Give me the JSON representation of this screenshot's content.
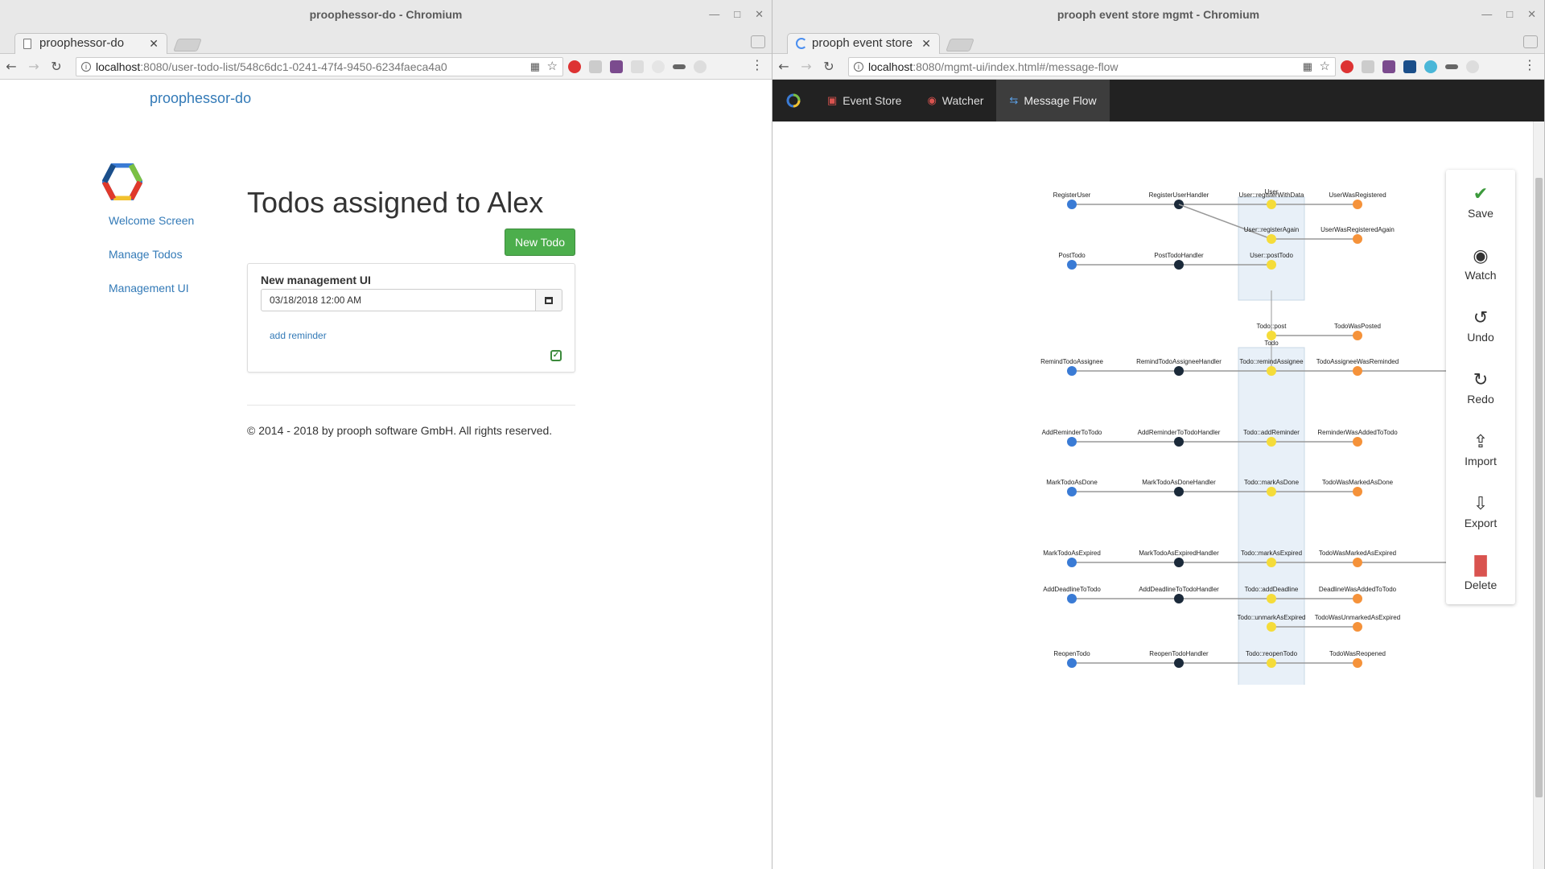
{
  "left_window": {
    "title": "proophessor-do - Chromium",
    "tab_label": "proophessor-do",
    "url_host": "localhost",
    "url_path": ":8080/user-todo-list/548c6dc1-0241-47f4-9450-6234faeca4a0",
    "page": {
      "brand": "proophessor-do",
      "nav": [
        "Welcome Screen",
        "Manage Todos",
        "Management UI"
      ],
      "heading": "Todos assigned to Alex",
      "new_todo_label": "New Todo",
      "todo": {
        "title": "New management UI",
        "date_value": "03/18/2018 12:00 AM",
        "add_reminder": "add reminder"
      },
      "footer": "© 2014 - 2018 by prooph software GmbH. All rights reserved."
    }
  },
  "right_window": {
    "title": "prooph event store mgmt - Chromium",
    "tab_label": "prooph event store",
    "url_host": "localhost",
    "url_path": ":8080/mgmt-ui/index.html#/message-flow",
    "nav": [
      {
        "label": "Event Store",
        "icon": "database-icon"
      },
      {
        "label": "Watcher",
        "icon": "eye-icon"
      },
      {
        "label": "Message Flow",
        "icon": "exchange-icon"
      }
    ],
    "actions": [
      "Save",
      "Watch",
      "Undo",
      "Redo",
      "Import",
      "Export",
      "Delete"
    ],
    "flow": {
      "aggregates": [
        "User",
        "Todo"
      ],
      "rows": [
        {
          "command": "RegisterUser",
          "handler": "RegisterUserHandler",
          "methods": [
            "User::registerWithData",
            "User::registerAgain"
          ],
          "events": [
            "UserWasRegistered",
            "UserWasRegisteredAgain"
          ]
        },
        {
          "command": "PostTodo",
          "handler": "PostTodoHandler",
          "methods": [
            "User::postTodo"
          ],
          "events": []
        },
        {
          "command": "",
          "handler": "",
          "methods": [
            "Todo::post"
          ],
          "events": [
            "TodoWasPosted"
          ]
        },
        {
          "command": "RemindTodoAssignee",
          "handler": "RemindTodoAssigneeHandler",
          "methods": [
            "Todo::remindAssignee"
          ],
          "events": [
            "TodoAssigneeWasReminded"
          ]
        },
        {
          "command": "AddReminderToTodo",
          "handler": "AddReminderToTodoHandler",
          "methods": [
            "Todo::addReminder"
          ],
          "events": [
            "ReminderWasAddedToTodo"
          ]
        },
        {
          "command": "MarkTodoAsDone",
          "handler": "MarkTodoAsDoneHandler",
          "methods": [
            "Todo::markAsDone"
          ],
          "events": [
            "TodoWasMarkedAsDone"
          ]
        },
        {
          "command": "MarkTodoAsExpired",
          "handler": "MarkTodoAsExpiredHandler",
          "methods": [
            "Todo::markAsExpired"
          ],
          "events": [
            "TodoWasMarkedAsExpired"
          ]
        },
        {
          "command": "AddDeadlineToTodo",
          "handler": "AddDeadlineToTodoHandler",
          "methods": [
            "Todo::addDeadline"
          ],
          "events": [
            "DeadlineWasAddedToTodo"
          ]
        },
        {
          "command": "",
          "handler": "",
          "methods": [
            "Todo::unmarkAsExpired"
          ],
          "events": [
            "TodoWasUnmarkedAsExpired"
          ]
        },
        {
          "command": "ReopenTodo",
          "handler": "ReopenTodoHandler",
          "methods": [
            "Todo::reopenTodo"
          ],
          "events": [
            "TodoWasReopened"
          ]
        }
      ]
    }
  },
  "colors": {
    "link": "#337ab7",
    "success": "#4cae4c",
    "nav_bg": "#222222",
    "command_node": "#3a7bd5",
    "handler_node": "#1b2a3a",
    "method_node": "#f5dc3a",
    "event_node": "#f5923a",
    "aggregate_box": "#e8f0f8"
  }
}
